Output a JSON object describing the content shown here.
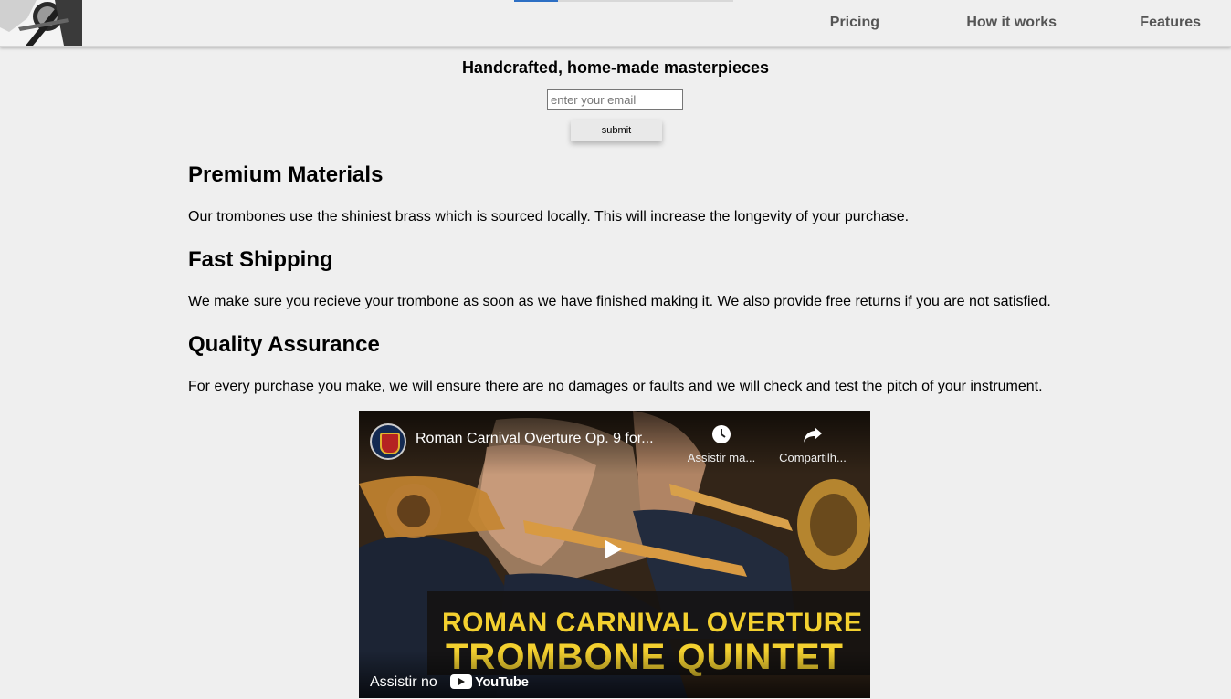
{
  "header": {
    "nav": [
      {
        "label": "Pricing"
      },
      {
        "label": "How it works"
      },
      {
        "label": "Features"
      }
    ],
    "progress": 0.2
  },
  "hero": {
    "title": "Handcrafted, home-made masterpieces",
    "email_placeholder": "enter your email",
    "submit_label": "submit"
  },
  "features": [
    {
      "title": "Premium Materials",
      "text": "Our trombones use the shiniest brass which is sourced locally. This will increase the longevity of your purchase."
    },
    {
      "title": "Fast Shipping",
      "text": "We make sure you recieve your trombone as soon as we have finished making it. We also provide free returns if you are not satisfied."
    },
    {
      "title": "Quality Assurance",
      "text": "For every purchase you make, we will ensure there are no damages or faults and we will check and test the pitch of your instrument."
    }
  ],
  "video": {
    "title": "Roman Carnival Overture Op. 9 for...",
    "watch_later": "Assistir ma...",
    "share": "Compartilh...",
    "banner_line1": "ROMAN CARNIVAL OVERTURE",
    "banner_line2": "TROMBONE QUINTET",
    "watch_on": "Assistir no",
    "platform": "YouTube"
  },
  "colors": {
    "background": "#efefef",
    "nav_text": "#555555",
    "banner_text": "#f3d02f",
    "progress_fill": "#2d6fc4"
  }
}
